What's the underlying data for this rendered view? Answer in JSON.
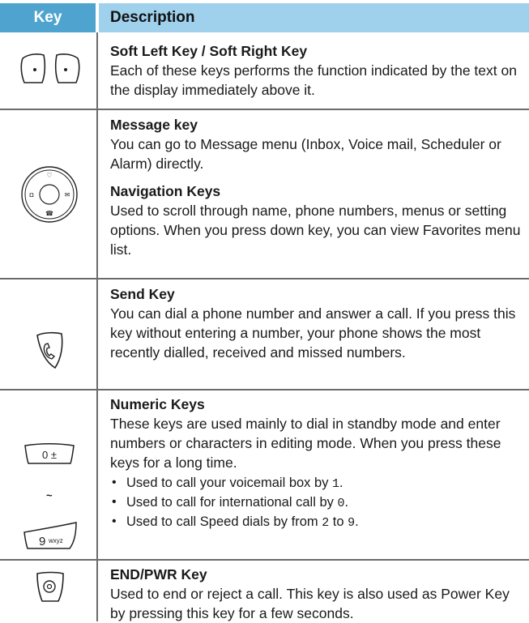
{
  "header": {
    "key_label": "Key",
    "desc_label": "Description"
  },
  "rows": [
    {
      "title": "Soft Left Key / Soft Right Key",
      "text": "Each of these keys performs the function indicated by the text on the display immediately above it."
    },
    {
      "title": "Message key",
      "text": "You can go to Message menu (Inbox, Voice mail, Scheduler or Alarm) directly.",
      "title2": "Navigation Keys",
      "text2": "Used to scroll through name, phone numbers, menus or setting options. When you press down key, you can view Favorites menu list."
    },
    {
      "title": "Send Key",
      "text": "You can dial a phone number and answer a call. If you press this key without entering a number, your phone shows the most recently dialled, received and missed numbers."
    },
    {
      "title": "Numeric Keys",
      "text": "These keys are used mainly to dial in standby mode and enter numbers or characters in editing mode. When you press these keys for a long time.",
      "bullets": [
        {
          "pre": "Used to call your voicemail box by ",
          "code": "1",
          "post": "."
        },
        {
          "pre": "Used to call for international call by ",
          "code": "0",
          "post": "."
        },
        {
          "pre": "Used to call Speed dials by from ",
          "code": "2",
          "mid": " to ",
          "code2": "9",
          "post": "."
        }
      ],
      "key_labels": {
        "zero": "0 ±",
        "tilde": "~",
        "nine": "9",
        "nine_sub": "wxyz"
      }
    },
    {
      "title": "END/PWR Key",
      "text": "Used to end or reject a call. This key is also used as Power Key by pressing this key for a few seconds."
    }
  ],
  "icons": [
    "soft-left-key-icon",
    "soft-right-key-icon",
    "navigation-pad-icon",
    "send-key-icon",
    "zero-key-icon",
    "nine-key-icon",
    "end-power-key-icon"
  ],
  "colors": {
    "header_key_bg": "#4fa4cf",
    "header_desc_bg": "#9fd0ec",
    "rule": "#6b6b6b"
  }
}
